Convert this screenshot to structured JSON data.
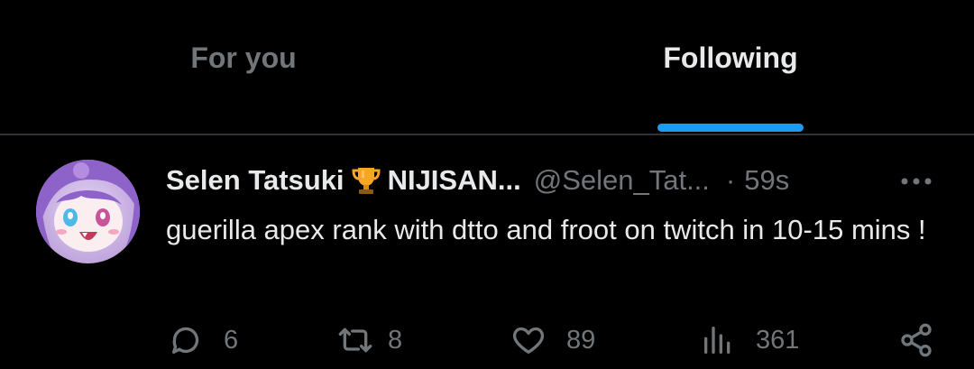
{
  "tabs": [
    {
      "label": "For you",
      "active": false
    },
    {
      "label": "Following",
      "active": true
    }
  ],
  "colors": {
    "background": "#000000",
    "accent": "#1d9bf0",
    "text_primary": "#e7e9ea",
    "text_secondary": "#71767b",
    "divider": "#2f3336"
  },
  "tweet": {
    "display_name": "Selen Tatsuki",
    "name_suffix": "NIJISAN...",
    "badge_icon": "trophy-icon",
    "handle": "@Selen_Tat...",
    "separator": "·",
    "time": "59s",
    "text": "guerilla apex rank with dtto and froot on twitch in 10-15 mins !",
    "actions": {
      "replies": "6",
      "reposts": "8",
      "likes": "89",
      "views": "361"
    },
    "icons": {
      "reply": "reply-icon",
      "repost": "repost-icon",
      "like": "heart-icon",
      "views": "views-icon",
      "share": "share-icon",
      "more": "more-icon"
    }
  }
}
